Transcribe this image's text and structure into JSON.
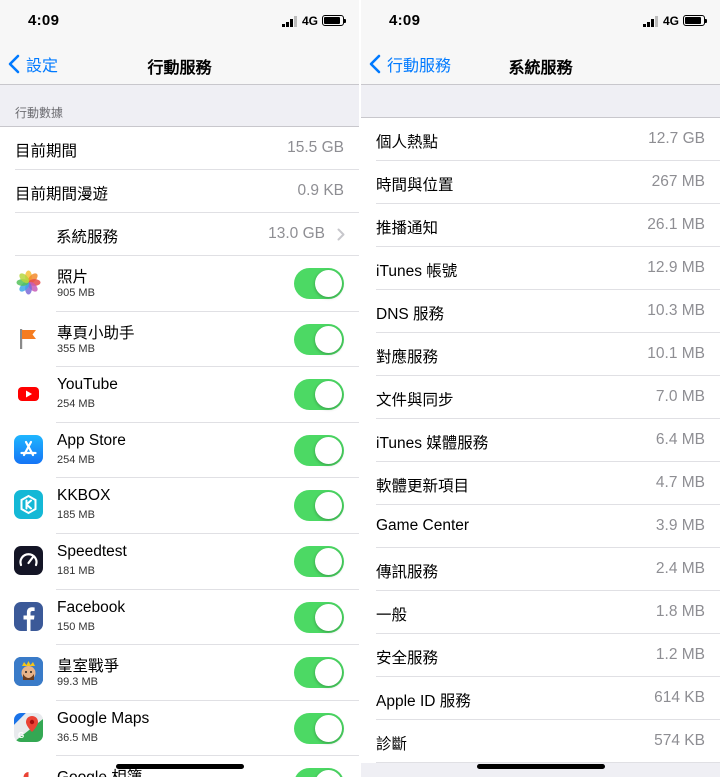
{
  "left": {
    "status": {
      "time": "4:09",
      "network": "4G"
    },
    "nav": {
      "back_label": "設定",
      "title": "行動服務"
    },
    "section_header": "行動數據",
    "summary_rows": [
      {
        "label": "目前期間",
        "value": "15.5 GB"
      },
      {
        "label": "目前期間漫遊",
        "value": "0.9 KB"
      }
    ],
    "system_services": {
      "label": "系統服務",
      "value": "13.0 GB"
    },
    "apps": [
      {
        "name": "照片",
        "size": "905 MB",
        "icon": "photos-icon",
        "enabled": true
      },
      {
        "name": "專頁小助手",
        "size": "355 MB",
        "icon": "pages-manager-icon",
        "enabled": true
      },
      {
        "name": "YouTube",
        "size": "254 MB",
        "icon": "youtube-icon",
        "enabled": true
      },
      {
        "name": "App Store",
        "size": "254 MB",
        "icon": "app-store-icon",
        "enabled": true
      },
      {
        "name": "KKBOX",
        "size": "185 MB",
        "icon": "kkbox-icon",
        "enabled": true
      },
      {
        "name": "Speedtest",
        "size": "181 MB",
        "icon": "speedtest-icon",
        "enabled": true
      },
      {
        "name": "Facebook",
        "size": "150 MB",
        "icon": "facebook-icon",
        "enabled": true
      },
      {
        "name": "皇室戰爭",
        "size": "99.3 MB",
        "icon": "clash-royale-icon",
        "enabled": true
      },
      {
        "name": "Google Maps",
        "size": "36.5 MB",
        "icon": "google-maps-icon",
        "enabled": true
      },
      {
        "name": "Google 相簿",
        "size": "",
        "icon": "google-photos-icon",
        "enabled": true
      }
    ]
  },
  "right": {
    "status": {
      "time": "4:09",
      "network": "4G"
    },
    "nav": {
      "back_label": "行動服務",
      "title": "系統服務"
    },
    "services": [
      {
        "label": "個人熱點",
        "value": "12.7 GB"
      },
      {
        "label": "時間與位置",
        "value": "267 MB"
      },
      {
        "label": "推播通知",
        "value": "26.1 MB"
      },
      {
        "label": "iTunes 帳號",
        "value": "12.9 MB"
      },
      {
        "label": "DNS 服務",
        "value": "10.3 MB"
      },
      {
        "label": "對應服務",
        "value": "10.1 MB"
      },
      {
        "label": "文件與同步",
        "value": "7.0 MB"
      },
      {
        "label": "iTunes 媒體服務",
        "value": "6.4 MB"
      },
      {
        "label": "軟體更新項目",
        "value": "4.7 MB"
      },
      {
        "label": "Game Center",
        "value": "3.9 MB"
      },
      {
        "label": "傳訊服務",
        "value": "2.4 MB"
      },
      {
        "label": "一般",
        "value": "1.8 MB"
      },
      {
        "label": "安全服務",
        "value": "1.2 MB"
      },
      {
        "label": "Apple ID 服務",
        "value": "614 KB"
      },
      {
        "label": "診斷",
        "value": "574 KB"
      }
    ]
  },
  "colors": {
    "accent": "#007aff",
    "toggle_on": "#4cd964",
    "secondary_text": "#8e8e93",
    "group_bg": "#efeff4"
  }
}
